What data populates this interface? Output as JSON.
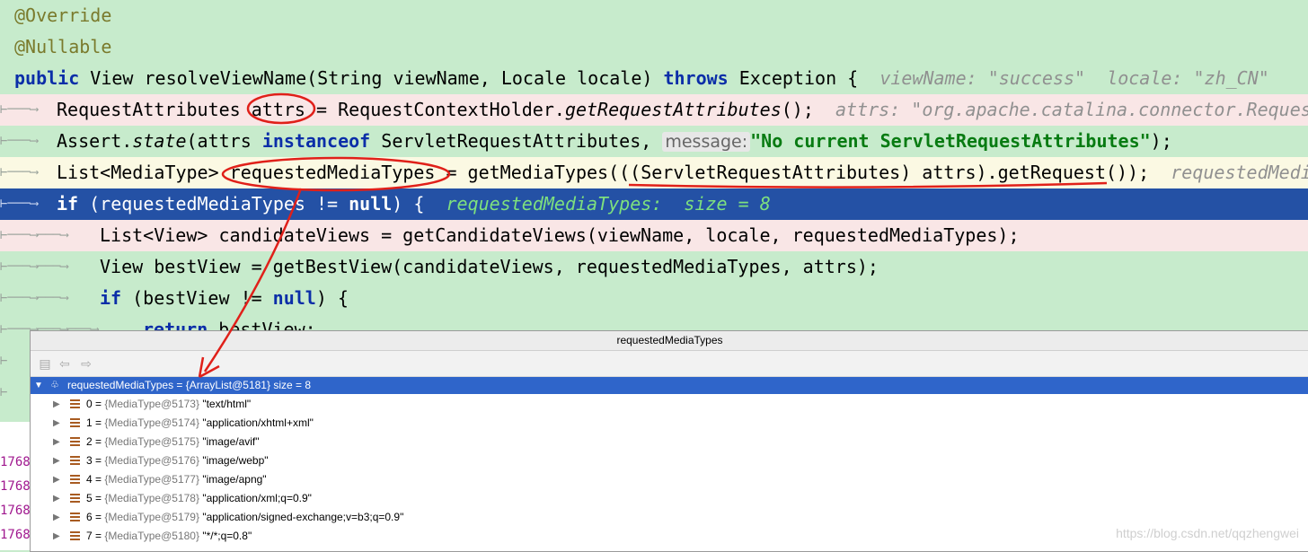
{
  "editor": {
    "line1": "@Override",
    "line2": "@Nullable",
    "line3_kw1": "public",
    "line3_code": " View resolveViewName(String viewName, Locale locale) ",
    "line3_kw2": "throws",
    "line3_code2": " Exception {",
    "line3_hint": "viewName: \"success\"  locale: \"zh_CN\"",
    "line4_a": "RequestAttributes attrs = RequestContextHolder.",
    "line4_it": "getRequestAttributes",
    "line4_b": "();",
    "line4_hint": "attrs: \"org.apache.catalina.connector.Request",
    "line5_a": "Assert.",
    "line5_it": "state",
    "line5_b": "(attrs ",
    "line5_kw": "instanceof",
    "line5_c": " ServletRequestAttributes, ",
    "line5_param": "message:",
    "line5_str": "\"No current ServletRequestAttributes\"",
    "line5_d": ");",
    "line6_a": "List<MediaType> requestedMediaTypes = getMediaTypes(((ServletRequestAttributes) attrs).getRequest());",
    "line6_hint": "requestedMedi",
    "line7_kw": "if",
    "line7_a": " (requestedMediaTypes != ",
    "line7_kw2": "null",
    "line7_b": ") {",
    "line7_hint": "requestedMediaTypes:  size = 8",
    "line8": "List<View> candidateViews = getCandidateViews(viewName, locale, requestedMediaTypes);",
    "line9": "View bestView = getBestView(candidateViews, requestedMediaTypes, attrs);",
    "line10_kw": "if",
    "line10_a": " (bestView != ",
    "line10_kw2": "null",
    "line10_b": ") {",
    "line11_kw": "return",
    "line11_a": " bestView;"
  },
  "left_numbers": [
    "1768",
    "1768",
    "1768",
    "1768"
  ],
  "popup": {
    "title": "requestedMediaTypes",
    "root": "requestedMediaTypes = {ArrayList@5181}  size = 8",
    "items": [
      {
        "index": "0",
        "type": "{MediaType@5173}",
        "value": "\"text/html\""
      },
      {
        "index": "1",
        "type": "{MediaType@5174}",
        "value": "\"application/xhtml+xml\""
      },
      {
        "index": "2",
        "type": "{MediaType@5175}",
        "value": "\"image/avif\""
      },
      {
        "index": "3",
        "type": "{MediaType@5176}",
        "value": "\"image/webp\""
      },
      {
        "index": "4",
        "type": "{MediaType@5177}",
        "value": "\"image/apng\""
      },
      {
        "index": "5",
        "type": "{MediaType@5178}",
        "value": "\"application/xml;q=0.9\""
      },
      {
        "index": "6",
        "type": "{MediaType@5179}",
        "value": "\"application/signed-exchange;v=b3;q=0.9\""
      },
      {
        "index": "7",
        "type": "{MediaType@5180}",
        "value": "\"*/*;q=0.8\""
      }
    ]
  },
  "watermark": "https://blog.csdn.net/qqzhengwei",
  "colors": {
    "editor_bg": "#c7ebcc",
    "selected_line": "#2451a5",
    "annotation_red": "#e0201a"
  }
}
